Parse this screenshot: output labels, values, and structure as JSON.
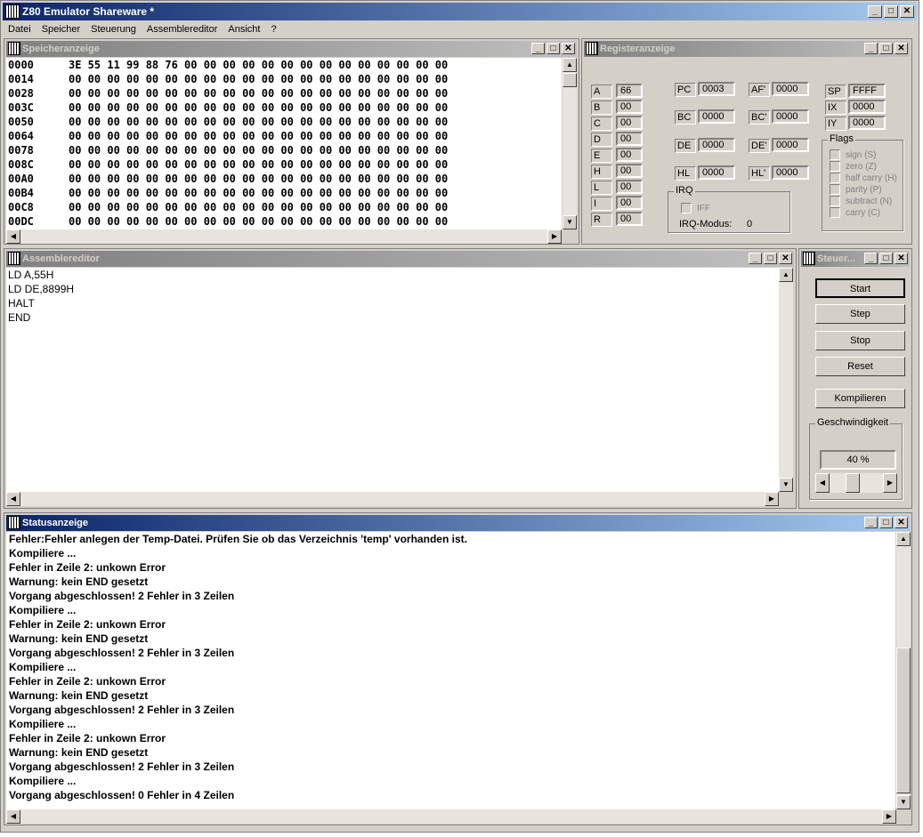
{
  "app": {
    "title": "Z80 Emulator Shareware *"
  },
  "menu": [
    "Datei",
    "Speicher",
    "Steuerung",
    "Assemblereditor",
    "Ansicht",
    "?"
  ],
  "memory": {
    "title": "Speicheranzeige",
    "rows": [
      {
        "addr": "0000",
        "bytes": "3E 55 11 99 88 76 00 00 00 00 00 00 00 00 00 00 00 00 00 00"
      },
      {
        "addr": "0014",
        "bytes": "00 00 00 00 00 00 00 00 00 00 00 00 00 00 00 00 00 00 00 00"
      },
      {
        "addr": "0028",
        "bytes": "00 00 00 00 00 00 00 00 00 00 00 00 00 00 00 00 00 00 00 00"
      },
      {
        "addr": "003C",
        "bytes": "00 00 00 00 00 00 00 00 00 00 00 00 00 00 00 00 00 00 00 00"
      },
      {
        "addr": "0050",
        "bytes": "00 00 00 00 00 00 00 00 00 00 00 00 00 00 00 00 00 00 00 00"
      },
      {
        "addr": "0064",
        "bytes": "00 00 00 00 00 00 00 00 00 00 00 00 00 00 00 00 00 00 00 00"
      },
      {
        "addr": "0078",
        "bytes": "00 00 00 00 00 00 00 00 00 00 00 00 00 00 00 00 00 00 00 00"
      },
      {
        "addr": "008C",
        "bytes": "00 00 00 00 00 00 00 00 00 00 00 00 00 00 00 00 00 00 00 00"
      },
      {
        "addr": "00A0",
        "bytes": "00 00 00 00 00 00 00 00 00 00 00 00 00 00 00 00 00 00 00 00"
      },
      {
        "addr": "00B4",
        "bytes": "00 00 00 00 00 00 00 00 00 00 00 00 00 00 00 00 00 00 00 00"
      },
      {
        "addr": "00C8",
        "bytes": "00 00 00 00 00 00 00 00 00 00 00 00 00 00 00 00 00 00 00 00"
      },
      {
        "addr": "00DC",
        "bytes": "00 00 00 00 00 00 00 00 00 00 00 00 00 00 00 00 00 00 00 00"
      }
    ]
  },
  "registers": {
    "title": "Registeranzeige",
    "r8": [
      {
        "name": "A",
        "value": "66"
      },
      {
        "name": "B",
        "value": "00"
      },
      {
        "name": "C",
        "value": "00"
      },
      {
        "name": "D",
        "value": "00"
      },
      {
        "name": "E",
        "value": "00"
      },
      {
        "name": "H",
        "value": "00"
      },
      {
        "name": "L",
        "value": "00"
      },
      {
        "name": "I",
        "value": "00"
      },
      {
        "name": "R",
        "value": "00"
      }
    ],
    "r16": [
      {
        "name": "PC",
        "value": "0003"
      },
      {
        "name": "AF'",
        "value": "0000"
      },
      {
        "name": "BC",
        "value": "0000"
      },
      {
        "name": "BC'",
        "value": "0000"
      },
      {
        "name": "DE",
        "value": "0000"
      },
      {
        "name": "DE'",
        "value": "0000"
      },
      {
        "name": "HL",
        "value": "0000"
      },
      {
        "name": "HL'",
        "value": "0000"
      },
      {
        "name": "SP",
        "value": "FFFF"
      },
      {
        "name": "IX",
        "value": "0000"
      },
      {
        "name": "IY",
        "value": "0000"
      }
    ],
    "irq": {
      "label": "IRQ",
      "iff": "IFF",
      "mode_label": "IRQ-Modus:",
      "mode": "0"
    },
    "flags": {
      "label": "Flags",
      "items": [
        "sign (S)",
        "zero (Z)",
        "half carry (H)",
        "parity (P)",
        "subtract (N)",
        "carry (C)"
      ]
    }
  },
  "editor": {
    "title": "Assemblereditor",
    "lines": [
      "LD A,55H",
      "LD DE,8899H",
      "HALT",
      "END"
    ]
  },
  "control": {
    "title": "Steuer...",
    "buttons": [
      "Start",
      "Step",
      "Stop",
      "Reset",
      "Kompilieren"
    ],
    "speed_label": "Geschwindigkeit",
    "speed_value": "40 %",
    "speed_fraction": 0.4
  },
  "status": {
    "title": "Statusanzeige",
    "lines": [
      "Fehler:Fehler anlegen der Temp-Datei. Prüfen Sie ob das Verzeichnis 'temp' vorhanden ist.",
      "Kompiliere ...",
      "Fehler in Zeile 2: unkown Error",
      "Warnung: kein END gesetzt",
      "Vorgang abgeschlossen! 2 Fehler in 3 Zeilen",
      "Kompiliere ...",
      "Fehler in Zeile 2: unkown Error",
      "Warnung: kein END gesetzt",
      "Vorgang abgeschlossen! 2 Fehler in 3 Zeilen",
      "Kompiliere ...",
      "Fehler in Zeile 2: unkown Error",
      "Warnung: kein END gesetzt",
      "Vorgang abgeschlossen! 2 Fehler in 3 Zeilen",
      "Kompiliere ...",
      "Fehler in Zeile 2: unkown Error",
      "Warnung: kein END gesetzt",
      "Vorgang abgeschlossen! 2 Fehler in 3 Zeilen",
      "Kompiliere ...",
      "Vorgang abgeschlossen! 0 Fehler in 4 Zeilen"
    ]
  },
  "window_buttons": {
    "min": "_",
    "max": "□",
    "close": "✕"
  }
}
